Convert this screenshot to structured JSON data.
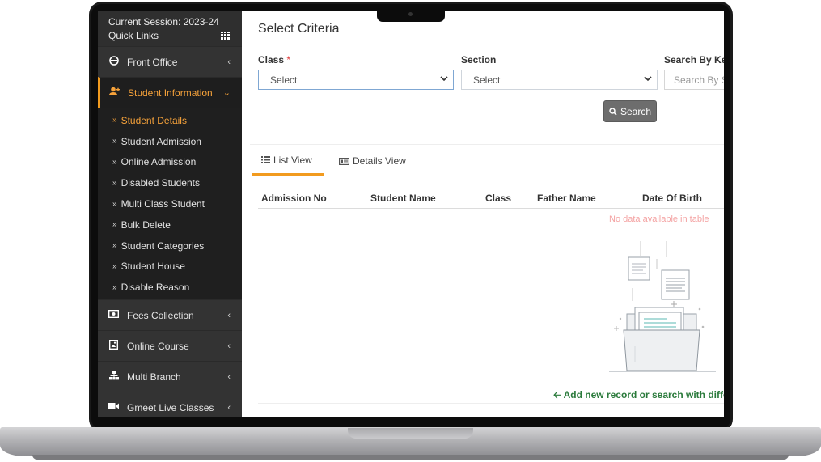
{
  "sidebar": {
    "session": "Current Session: 2023-24",
    "quick_links": "Quick Links",
    "front_office": "Front Office",
    "student_information": "Student Information",
    "submenu": [
      "Student Details",
      "Student Admission",
      "Online Admission",
      "Disabled Students",
      "Multi Class Student",
      "Bulk Delete",
      "Student Categories",
      "Student House",
      "Disable Reason"
    ],
    "fees_collection": "Fees Collection",
    "online_course": "Online Course",
    "multi_branch": "Multi Branch",
    "gmeet": "Gmeet Live Classes"
  },
  "criteria": {
    "title": "Select Criteria",
    "class_label": "Class",
    "required_mark": "*",
    "class_value": "Select",
    "section_label": "Section",
    "section_value": "Select",
    "keyword_label": "Search By Key",
    "keyword_placeholder": "Search By S",
    "search_button": "Search"
  },
  "tabs": {
    "list_view": "List View",
    "details_view": "Details View"
  },
  "table": {
    "headers": [
      "Admission No",
      "Student Name",
      "Class",
      "Father Name",
      "Date Of Birth"
    ],
    "empty_message": "No data available in table",
    "add_link": "Add new record or search with differe"
  },
  "colors": {
    "accent": "#f29b1f",
    "sidebar_bg": "#2a2a2a",
    "link_green": "#2a7a3b",
    "empty_text": "#f4a3a3"
  }
}
